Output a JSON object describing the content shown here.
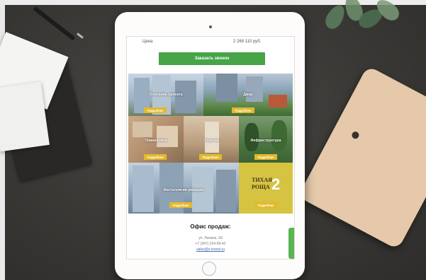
{
  "page": {
    "price_label": "Цена",
    "price_value": "2 269 110 руб.",
    "order_button": "Заказать звонок"
  },
  "tiles": [
    {
      "label": "Описание проекта",
      "button": "Подробнее"
    },
    {
      "label": "Двор",
      "button": "Подробнее"
    },
    {
      "label": "Планировка",
      "button": "Подробнее"
    },
    {
      "label": "Отделка",
      "button": "Подробнее"
    },
    {
      "label": "Инфраструктура",
      "button": "Подробнее"
    },
    {
      "label": "Инсталлягия рнвиция",
      "button": "Подробнее"
    },
    {
      "label": "",
      "button": "Подробнее"
    }
  ],
  "logo": {
    "text_line1": "ТИХАЯ",
    "text_line2": "РОЩА",
    "number": "2"
  },
  "office": {
    "title": "Офис продаж:",
    "address": "ул. Ленина, 93",
    "phone": "+7 (347) 224-99-42",
    "link": "sales@s-invest.ru"
  },
  "colors": {
    "accent_green": "#47a447",
    "button_gold": "#e3b92b",
    "logo_bg": "#d6c341"
  }
}
